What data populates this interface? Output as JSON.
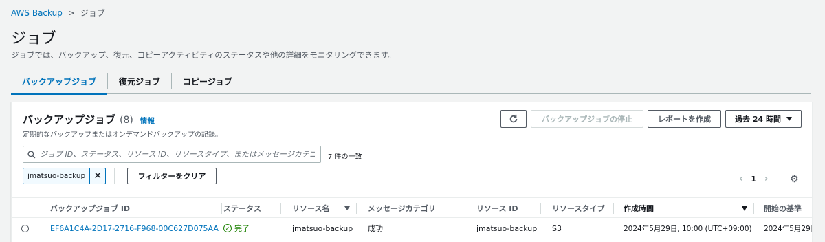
{
  "breadcrumb": {
    "root": "AWS Backup",
    "current": "ジョブ"
  },
  "page": {
    "title": "ジョブ",
    "description": "ジョブでは、バックアップ、復元、コピーアクティビティのステータスや他の詳細をモニタリングできます。"
  },
  "tabs": [
    {
      "label": "バックアップジョブ",
      "active": true
    },
    {
      "label": "復元ジョブ",
      "active": false
    },
    {
      "label": "コピージョブ",
      "active": false
    }
  ],
  "panel": {
    "title": "バックアップジョブ",
    "count": "(8)",
    "info": "情報",
    "description": "定期的なバックアップまたはオンデマンドバックアップの記録。",
    "buttons": {
      "stop": "バックアップジョブの停止",
      "report": "レポートを作成",
      "range": "過去 24 時間"
    },
    "search_placeholder": "ジョブ ID、ステータス、リソース ID、リソースタイプ、またはメッセージカテゴリ",
    "match_count": "7 件の一致",
    "filter_token": "jmatsuo-backup",
    "clear_filters": "フィルターをクリア",
    "page_number": "1"
  },
  "table": {
    "columns": [
      "バックアップジョブ ID",
      "ステータス",
      "リソース名",
      "メッセージカテゴリ",
      "リソース ID",
      "リソースタイプ",
      "作成時間",
      "開始の基準"
    ],
    "rows": [
      {
        "job_id": "EF6A1C4A-2D17-2716-F968-00C627D075AA",
        "status": "完了",
        "resource_name": "jmatsuo-backup",
        "message_category": "成功",
        "resource_id": "jmatsuo-backup",
        "resource_type": "S3",
        "created": "2024年5月29日, 10:00 (UTC+09:00)",
        "start_by": "2024年5月29日"
      }
    ]
  },
  "colors": {
    "link": "#0073bb",
    "success": "#1d8102",
    "background": "#f2f3f3"
  },
  "icons": [
    "chevron-right-icon",
    "refresh-icon",
    "caret-down-icon",
    "search-icon",
    "close-icon",
    "chevron-left-icon",
    "settings-icon",
    "sort-icon",
    "success-icon"
  ]
}
